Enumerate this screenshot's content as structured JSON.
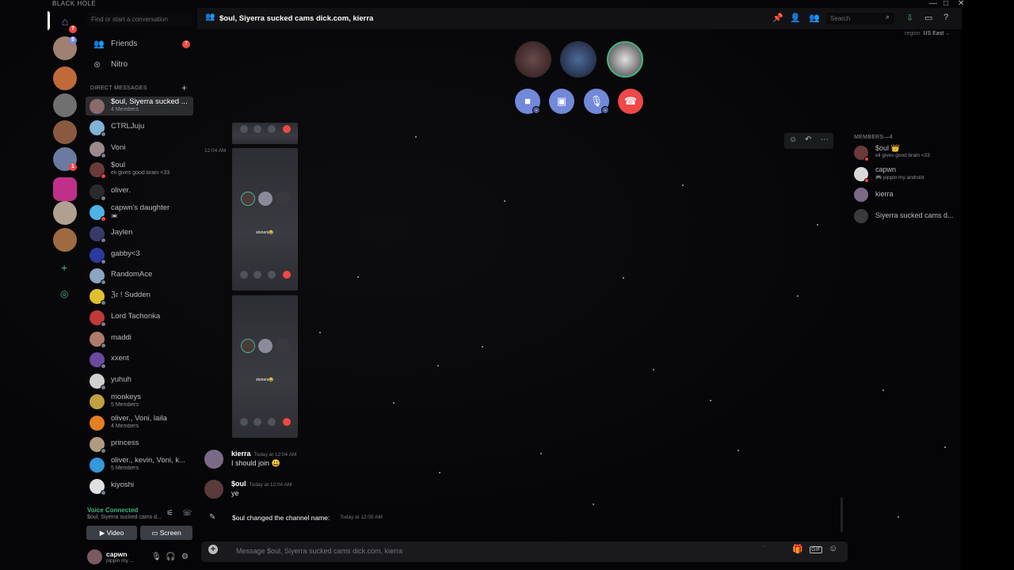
{
  "app": {
    "brand": "BLACK HOLE",
    "window_controls": [
      "—",
      "□",
      "✕"
    ]
  },
  "servers": {
    "home_badge": "7",
    "server_badge_2": "5",
    "server_badge_8": "1"
  },
  "sidebar": {
    "search_placeholder": "Find or start a conversation",
    "friends_label": "Friends",
    "friends_badge": "7",
    "nitro_label": "Nitro",
    "dm_header": "DIRECT MESSAGES",
    "dms": [
      {
        "name": "$oul, Siyerra sucked ...",
        "sub": "4 Members",
        "color": "#8a6a6a",
        "status": "none"
      },
      {
        "name": "CTRLJuju",
        "sub": "",
        "color": "#7fb4d8",
        "status": "offline"
      },
      {
        "name": "Voni",
        "sub": "",
        "color": "#9a8a8e",
        "status": "offline"
      },
      {
        "name": "$oul",
        "sub": "eli gives good brain <33",
        "color": "#6a3a3a",
        "status": "dnd"
      },
      {
        "name": "oliver.",
        "sub": "",
        "color": "#2a2a2e",
        "status": "offline"
      },
      {
        "name": "capwn's daughter",
        "sub": "📼",
        "color": "#4fb3e8",
        "status": "dnd"
      },
      {
        "name": "Jaylen",
        "sub": "",
        "color": "#3a3a6a",
        "status": "offline"
      },
      {
        "name": "gabby<3",
        "sub": "",
        "color": "#2a3aa0",
        "status": "offline"
      },
      {
        "name": "RandomAce",
        "sub": "",
        "color": "#8aa6c0",
        "status": "offline"
      },
      {
        "name": "ℨ𝔯 ! Sudden",
        "sub": "",
        "color": "#e0c030",
        "status": "offline"
      },
      {
        "name": "Lord Tachonka",
        "sub": "",
        "color": "#c03a3a",
        "status": "offline"
      },
      {
        "name": "maddi",
        "sub": "",
        "color": "#b07a6a",
        "status": "offline"
      },
      {
        "name": "xxent",
        "sub": "",
        "color": "#6a4aa0",
        "status": "offline"
      },
      {
        "name": "yuhuh",
        "sub": "",
        "color": "#d0d0d0",
        "status": "offline"
      },
      {
        "name": "monkeys",
        "sub": "5 Members",
        "color": "#c0a040",
        "status": "none"
      },
      {
        "name": "oliver., Voni, laila",
        "sub": "4 Members",
        "color": "#e67e22",
        "status": "none"
      },
      {
        "name": "princess",
        "sub": "",
        "color": "#b09a80",
        "status": "offline"
      },
      {
        "name": "oliver., kevin, Voni, k...",
        "sub": "5 Members",
        "color": "#3498db",
        "status": "none"
      },
      {
        "name": "kiyoshi",
        "sub": "",
        "color": "#e0e0e0",
        "status": "offline"
      }
    ]
  },
  "voice": {
    "status": "Voice Connected",
    "channel": "$oul, Siyerra sucked cams d...",
    "video_label": "Video",
    "screen_label": "Screen"
  },
  "user": {
    "name": "capwn",
    "status": "pippin my ..."
  },
  "header": {
    "title": "$oul, Siyerra sucked cams dick.com, kierra",
    "search_placeholder": "Search",
    "region_label": "region",
    "region_value": "US East"
  },
  "messages": {
    "attachment_time": "12:04 AM",
    "attachment_caption": "stoners😂",
    "items": [
      {
        "author": "kierra",
        "time": "Today at 12:04 AM",
        "text": "I should join 😃",
        "color": "#7a6a88"
      },
      {
        "author": "$oul",
        "time": "Today at 12:04 AM",
        "text": "ye",
        "color": "#5a3a3a"
      }
    ],
    "system": {
      "text": "$oul changed the channel name:",
      "time": "Today at 12:05 AM"
    }
  },
  "composer": {
    "placeholder": "Message $oul, Siyerra sucked cams dick.com, kierra",
    "gif_label": "GIF"
  },
  "members": {
    "header": "MEMBERS—4",
    "list": [
      {
        "name": "$oul 👑",
        "sub": "eli gives good brain <33",
        "color": "#6a3a3a"
      },
      {
        "name": "capwn",
        "sub": "🎮 pippin my android",
        "color": "#d8d8d8"
      },
      {
        "name": "kierra",
        "sub": "",
        "color": "#7a6a88"
      },
      {
        "name": "Siyerra sucked cams d...",
        "sub": "",
        "color": "#3a3a3e"
      }
    ]
  }
}
